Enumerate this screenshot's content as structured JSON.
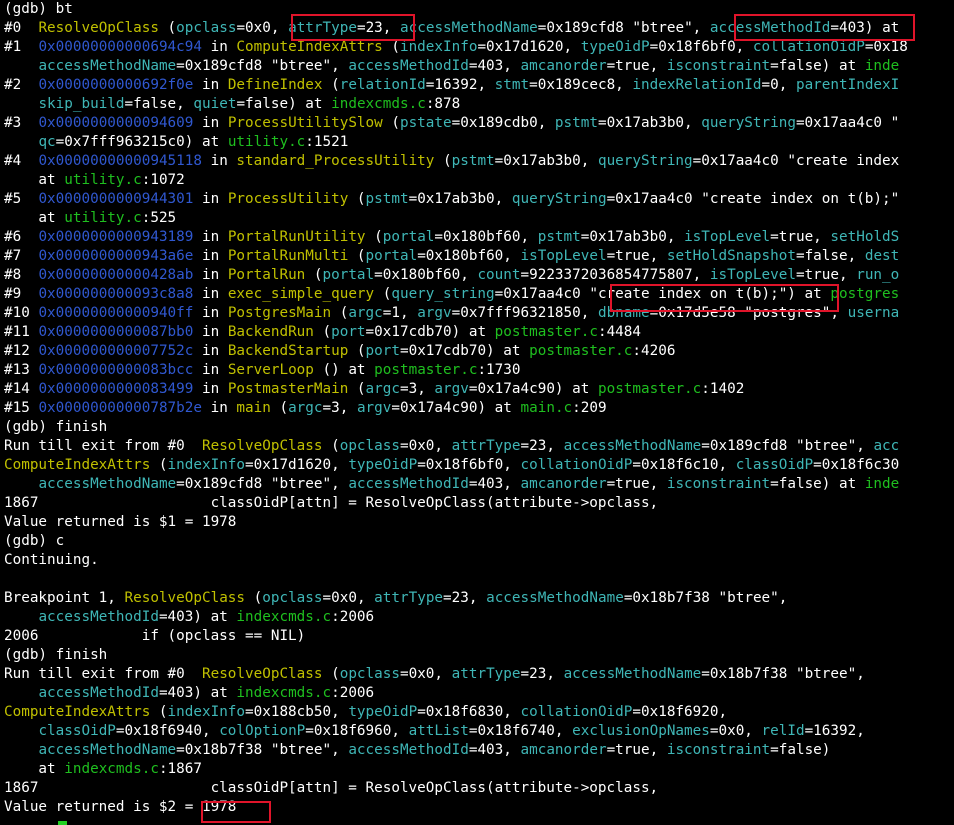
{
  "terminal": {
    "colors": {
      "background": "#000000",
      "text": "#ffffff",
      "function": "#c0c000",
      "param": "#3fb6b6",
      "address": "#3058d0",
      "file": "#1fbf1f",
      "highlight_box": "#e0142a",
      "cursor": "#22d022"
    },
    "lines": [
      [
        [
          "w",
          "(gdb) bt"
        ]
      ],
      [
        [
          "w",
          "#0  "
        ],
        [
          "y",
          "ResolveOpClass"
        ],
        [
          "w",
          " ("
        ],
        [
          "c",
          "opclass"
        ],
        [
          "w",
          "=0x0, "
        ],
        [
          "c",
          "attrType"
        ],
        [
          "w",
          "=23, "
        ],
        [
          "c",
          "accessMethodName"
        ],
        [
          "w",
          "=0x189cfd8 \"btree\", "
        ],
        [
          "c",
          "accessMethodId"
        ],
        [
          "w",
          "=403) at "
        ]
      ],
      [
        [
          "w",
          "#1  "
        ],
        [
          "b",
          "0x00000000000694c94"
        ],
        [
          "w",
          " in "
        ],
        [
          "y",
          "ComputeIndexAttrs"
        ],
        [
          "w",
          " ("
        ],
        [
          "c",
          "indexInfo"
        ],
        [
          "w",
          "=0x17d1620, "
        ],
        [
          "c",
          "typeOidP"
        ],
        [
          "w",
          "=0x18f6bf0, "
        ],
        [
          "c",
          "collationOidP"
        ],
        [
          "w",
          "=0x18"
        ]
      ],
      [
        [
          "w",
          "    "
        ],
        [
          "c",
          "accessMethodName"
        ],
        [
          "w",
          "=0x189cfd8 \"btree\", "
        ],
        [
          "c",
          "accessMethodId"
        ],
        [
          "w",
          "=403, "
        ],
        [
          "c",
          "amcanorder"
        ],
        [
          "w",
          "=true, "
        ],
        [
          "c",
          "isconstraint"
        ],
        [
          "w",
          "=false) at "
        ],
        [
          "g",
          "inde"
        ]
      ],
      [
        [
          "w",
          "#2  "
        ],
        [
          "b",
          "0x0000000000692f0e"
        ],
        [
          "w",
          " in "
        ],
        [
          "y",
          "DefineIndex"
        ],
        [
          "w",
          " ("
        ],
        [
          "c",
          "relationId"
        ],
        [
          "w",
          "=16392, "
        ],
        [
          "c",
          "stmt"
        ],
        [
          "w",
          "=0x189cec8, "
        ],
        [
          "c",
          "indexRelationId"
        ],
        [
          "w",
          "=0, "
        ],
        [
          "c",
          "parentIndexI"
        ]
      ],
      [
        [
          "w",
          "    "
        ],
        [
          "c",
          "skip_build"
        ],
        [
          "w",
          "=false, "
        ],
        [
          "c",
          "quiet"
        ],
        [
          "w",
          "=false) at "
        ],
        [
          "g",
          "indexcmds.c"
        ],
        [
          "w",
          ":878"
        ]
      ],
      [
        [
          "w",
          "#3  "
        ],
        [
          "b",
          "0x0000000000094609"
        ],
        [
          "w",
          " in "
        ],
        [
          "y",
          "ProcessUtilitySlow"
        ],
        [
          "w",
          " ("
        ],
        [
          "c",
          "pstate"
        ],
        [
          "w",
          "=0x189cdb0, "
        ],
        [
          "c",
          "pstmt"
        ],
        [
          "w",
          "=0x17ab3b0, "
        ],
        [
          "c",
          "queryString"
        ],
        [
          "w",
          "=0x17aa4c0 \""
        ]
      ],
      [
        [
          "w",
          "    "
        ],
        [
          "c",
          "qc"
        ],
        [
          "w",
          "=0x7fff963215c0) at "
        ],
        [
          "g",
          "utility.c"
        ],
        [
          "w",
          ":1521"
        ]
      ],
      [
        [
          "w",
          "#4  "
        ],
        [
          "b",
          "0x00000000000945118"
        ],
        [
          "w",
          " in "
        ],
        [
          "y",
          "standard_ProcessUtility"
        ],
        [
          "w",
          " ("
        ],
        [
          "c",
          "pstmt"
        ],
        [
          "w",
          "=0x17ab3b0, "
        ],
        [
          "c",
          "queryString"
        ],
        [
          "w",
          "=0x17aa4c0 \"create index"
        ]
      ],
      [
        [
          "w",
          "    at "
        ],
        [
          "g",
          "utility.c"
        ],
        [
          "w",
          ":1072"
        ]
      ],
      [
        [
          "w",
          "#5  "
        ],
        [
          "b",
          "0x0000000000944301"
        ],
        [
          "w",
          " in "
        ],
        [
          "y",
          "ProcessUtility"
        ],
        [
          "w",
          " ("
        ],
        [
          "c",
          "pstmt"
        ],
        [
          "w",
          "=0x17ab3b0, "
        ],
        [
          "c",
          "queryString"
        ],
        [
          "w",
          "=0x17aa4c0 \"create index on t(b);\""
        ]
      ],
      [
        [
          "w",
          "    at "
        ],
        [
          "g",
          "utility.c"
        ],
        [
          "w",
          ":525"
        ]
      ],
      [
        [
          "w",
          "#6  "
        ],
        [
          "b",
          "0x0000000000943189"
        ],
        [
          "w",
          " in "
        ],
        [
          "y",
          "PortalRunUtility"
        ],
        [
          "w",
          " ("
        ],
        [
          "c",
          "portal"
        ],
        [
          "w",
          "=0x180bf60, "
        ],
        [
          "c",
          "pstmt"
        ],
        [
          "w",
          "=0x17ab3b0, "
        ],
        [
          "c",
          "isTopLevel"
        ],
        [
          "w",
          "=true, "
        ],
        [
          "c",
          "setHoldS"
        ]
      ],
      [
        [
          "w",
          "#7  "
        ],
        [
          "b",
          "0x0000000000943a6e"
        ],
        [
          "w",
          " in "
        ],
        [
          "y",
          "PortalRunMulti"
        ],
        [
          "w",
          " ("
        ],
        [
          "c",
          "portal"
        ],
        [
          "w",
          "=0x180bf60, "
        ],
        [
          "c",
          "isTopLevel"
        ],
        [
          "w",
          "=true, "
        ],
        [
          "c",
          "setHoldSnapshot"
        ],
        [
          "w",
          "=false, "
        ],
        [
          "c",
          "dest"
        ]
      ],
      [
        [
          "w",
          "#8  "
        ],
        [
          "b",
          "0x00000000000428ab"
        ],
        [
          "w",
          " in "
        ],
        [
          "y",
          "PortalRun"
        ],
        [
          "w",
          " ("
        ],
        [
          "c",
          "portal"
        ],
        [
          "w",
          "=0x180bf60, "
        ],
        [
          "c",
          "count"
        ],
        [
          "w",
          "=9223372036854775807, "
        ],
        [
          "c",
          "isTopLevel"
        ],
        [
          "w",
          "=true, "
        ],
        [
          "c",
          "run_o"
        ]
      ],
      [
        [
          "w",
          "#9  "
        ],
        [
          "b",
          "0x000000000093c8a8"
        ],
        [
          "w",
          " in "
        ],
        [
          "y",
          "exec_simple_query"
        ],
        [
          "w",
          " ("
        ],
        [
          "c",
          "query_string"
        ],
        [
          "w",
          "=0x17aa4c0 \"create index on t(b);\") at "
        ],
        [
          "g",
          "postgres"
        ]
      ],
      [
        [
          "w",
          "#10 "
        ],
        [
          "b",
          "0x00000000000940ff"
        ],
        [
          "w",
          " in "
        ],
        [
          "y",
          "PostgresMain"
        ],
        [
          "w",
          " ("
        ],
        [
          "c",
          "argc"
        ],
        [
          "w",
          "=1, "
        ],
        [
          "c",
          "argv"
        ],
        [
          "w",
          "=0x7fff96321850, "
        ],
        [
          "c",
          "dbname"
        ],
        [
          "w",
          "=0x17d5e58 \"postgres\", "
        ],
        [
          "c",
          "userna"
        ]
      ],
      [
        [
          "w",
          "#11 "
        ],
        [
          "b",
          "0x0000000000087bb0"
        ],
        [
          "w",
          " in "
        ],
        [
          "y",
          "BackendRun"
        ],
        [
          "w",
          " ("
        ],
        [
          "c",
          "port"
        ],
        [
          "w",
          "=0x17cdb70) at "
        ],
        [
          "g",
          "postmaster.c"
        ],
        [
          "w",
          ":4484"
        ]
      ],
      [
        [
          "w",
          "#12 "
        ],
        [
          "b",
          "0x000000000007752c"
        ],
        [
          "w",
          " in "
        ],
        [
          "y",
          "BackendStartup"
        ],
        [
          "w",
          " ("
        ],
        [
          "c",
          "port"
        ],
        [
          "w",
          "=0x17cdb70) at "
        ],
        [
          "g",
          "postmaster.c"
        ],
        [
          "w",
          ":4206"
        ]
      ],
      [
        [
          "w",
          "#13 "
        ],
        [
          "b",
          "0x0000000000083bcc"
        ],
        [
          "w",
          " in "
        ],
        [
          "y",
          "ServerLoop"
        ],
        [
          "w",
          " () at "
        ],
        [
          "g",
          "postmaster.c"
        ],
        [
          "w",
          ":1730"
        ]
      ],
      [
        [
          "w",
          "#14 "
        ],
        [
          "b",
          "0x0000000000083499"
        ],
        [
          "w",
          " in "
        ],
        [
          "y",
          "PostmasterMain"
        ],
        [
          "w",
          " ("
        ],
        [
          "c",
          "argc"
        ],
        [
          "w",
          "=3, "
        ],
        [
          "c",
          "argv"
        ],
        [
          "w",
          "=0x17a4c90) at "
        ],
        [
          "g",
          "postmaster.c"
        ],
        [
          "w",
          ":1402"
        ]
      ],
      [
        [
          "w",
          "#15 "
        ],
        [
          "b",
          "0x00000000000787b2e"
        ],
        [
          "w",
          " in "
        ],
        [
          "y",
          "main"
        ],
        [
          "w",
          " ("
        ],
        [
          "c",
          "argc"
        ],
        [
          "w",
          "=3, "
        ],
        [
          "c",
          "argv"
        ],
        [
          "w",
          "=0x17a4c90) at "
        ],
        [
          "g",
          "main.c"
        ],
        [
          "w",
          ":209"
        ]
      ],
      [
        [
          "w",
          "(gdb) finish"
        ]
      ],
      [
        [
          "w",
          "Run till exit from #0  "
        ],
        [
          "y",
          "ResolveOpClass"
        ],
        [
          "w",
          " ("
        ],
        [
          "c",
          "opclass"
        ],
        [
          "w",
          "=0x0, "
        ],
        [
          "c",
          "attrType"
        ],
        [
          "w",
          "=23, "
        ],
        [
          "c",
          "accessMethodName"
        ],
        [
          "w",
          "=0x189cfd8 \"btree\", "
        ],
        [
          "c",
          "acc"
        ]
      ],
      [
        [
          "y",
          "ComputeIndexAttrs"
        ],
        [
          "w",
          " ("
        ],
        [
          "c",
          "indexInfo"
        ],
        [
          "w",
          "=0x17d1620, "
        ],
        [
          "c",
          "typeOidP"
        ],
        [
          "w",
          "=0x18f6bf0, "
        ],
        [
          "c",
          "collationOidP"
        ],
        [
          "w",
          "=0x18f6c10, "
        ],
        [
          "c",
          "classOidP"
        ],
        [
          "w",
          "=0x18f6c30"
        ]
      ],
      [
        [
          "w",
          "    "
        ],
        [
          "c",
          "accessMethodName"
        ],
        [
          "w",
          "=0x189cfd8 \"btree\", "
        ],
        [
          "c",
          "accessMethodId"
        ],
        [
          "w",
          "=403, "
        ],
        [
          "c",
          "amcanorder"
        ],
        [
          "w",
          "=true, "
        ],
        [
          "c",
          "isconstraint"
        ],
        [
          "w",
          "=false) at "
        ],
        [
          "g",
          "inde"
        ]
      ],
      [
        [
          "w",
          "1867                    classOidP[attn] = ResolveOpClass(attribute->opclass,"
        ]
      ],
      [
        [
          "w",
          "Value returned is $1 = 1978"
        ]
      ],
      [
        [
          "w",
          "(gdb) c"
        ]
      ],
      [
        [
          "w",
          "Continuing."
        ]
      ],
      [
        [
          "w",
          ""
        ]
      ],
      [
        [
          "w",
          "Breakpoint 1, "
        ],
        [
          "y",
          "ResolveOpClass"
        ],
        [
          "w",
          " ("
        ],
        [
          "c",
          "opclass"
        ],
        [
          "w",
          "=0x0, "
        ],
        [
          "c",
          "attrType"
        ],
        [
          "w",
          "=23, "
        ],
        [
          "c",
          "accessMethodName"
        ],
        [
          "w",
          "=0x18b7f38 \"btree\","
        ]
      ],
      [
        [
          "w",
          "    "
        ],
        [
          "c",
          "accessMethodId"
        ],
        [
          "w",
          "=403) at "
        ],
        [
          "g",
          "indexcmds.c"
        ],
        [
          "w",
          ":2006"
        ]
      ],
      [
        [
          "w",
          "2006            if (opclass == NIL)"
        ]
      ],
      [
        [
          "w",
          "(gdb) finish"
        ]
      ],
      [
        [
          "w",
          "Run till exit from #0  "
        ],
        [
          "y",
          "ResolveOpClass"
        ],
        [
          "w",
          " ("
        ],
        [
          "c",
          "opclass"
        ],
        [
          "w",
          "=0x0, "
        ],
        [
          "c",
          "attrType"
        ],
        [
          "w",
          "=23, "
        ],
        [
          "c",
          "accessMethodName"
        ],
        [
          "w",
          "=0x18b7f38 \"btree\","
        ]
      ],
      [
        [
          "w",
          "    "
        ],
        [
          "c",
          "accessMethodId"
        ],
        [
          "w",
          "=403) at "
        ],
        [
          "g",
          "indexcmds.c"
        ],
        [
          "w",
          ":2006"
        ]
      ],
      [
        [
          "y",
          "ComputeIndexAttrs"
        ],
        [
          "w",
          " ("
        ],
        [
          "c",
          "indexInfo"
        ],
        [
          "w",
          "=0x188cb50, "
        ],
        [
          "c",
          "typeOidP"
        ],
        [
          "w",
          "=0x18f6830, "
        ],
        [
          "c",
          "collationOidP"
        ],
        [
          "w",
          "=0x18f6920,"
        ]
      ],
      [
        [
          "w",
          "    "
        ],
        [
          "c",
          "classOidP"
        ],
        [
          "w",
          "=0x18f6940, "
        ],
        [
          "c",
          "colOptionP"
        ],
        [
          "w",
          "=0x18f6960, "
        ],
        [
          "c",
          "attList"
        ],
        [
          "w",
          "=0x18f6740, "
        ],
        [
          "c",
          "exclusionOpNames"
        ],
        [
          "w",
          "=0x0, "
        ],
        [
          "c",
          "relId"
        ],
        [
          "w",
          "=16392,"
        ]
      ],
      [
        [
          "w",
          "    "
        ],
        [
          "c",
          "accessMethodName"
        ],
        [
          "w",
          "=0x18b7f38 \"btree\", "
        ],
        [
          "c",
          "accessMethodId"
        ],
        [
          "w",
          "=403, "
        ],
        [
          "c",
          "amcanorder"
        ],
        [
          "w",
          "=true, "
        ],
        [
          "c",
          "isconstraint"
        ],
        [
          "w",
          "=false)"
        ]
      ],
      [
        [
          "w",
          "    at "
        ],
        [
          "g",
          "indexcmds.c"
        ],
        [
          "w",
          ":1867"
        ]
      ],
      [
        [
          "w",
          "1867                    classOidP[attn] = ResolveOpClass(attribute->opclass,"
        ]
      ],
      [
        [
          "w",
          "Value returned is $2 = 1978"
        ]
      ]
    ]
  }
}
